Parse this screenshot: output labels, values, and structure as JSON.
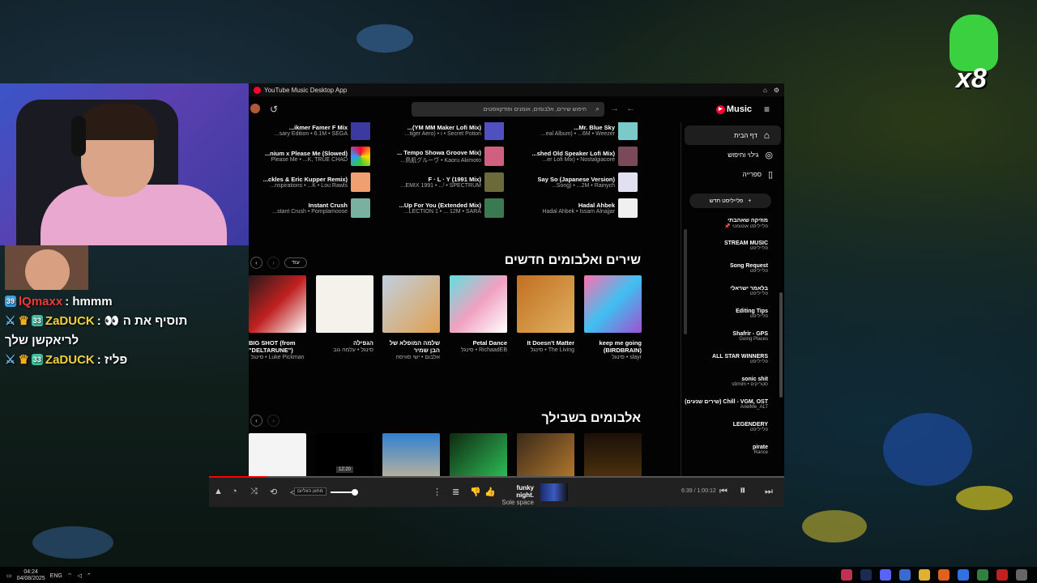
{
  "chat": {
    "lines": [
      {
        "name": "lQmaxx",
        "msg": ": hmmm"
      },
      {
        "name": "ZaDUCK",
        "msg": ": 👀 תוסיף את ה"
      },
      {
        "name": "",
        "msg": "לריאקשן שלך"
      },
      {
        "name": "ZaDUCK",
        "msg": ": פליז"
      }
    ],
    "badge_sub": "39",
    "badge_33": "33"
  },
  "overlay": {
    "counter": "x8"
  },
  "window": {
    "title": "YouTube Music Desktop App"
  },
  "topbar": {
    "search_placeholder": "חיפוש שירים, אלבומים, אומנים ופודקאסטים",
    "brand": "Music",
    "back": "←",
    "forward": "→"
  },
  "quick_picks": [
    [
      {
        "t1": "...ikmer Famer F Mix",
        "t2": "...sary Edition • 6.1M • SEGA",
        "c": "#3a3aa0"
      },
      {
        "t1": "...nium x Please Me (Slowed)",
        "t2": "Please Me • ...K, TRUE CHAD",
        "c": "#ffd020"
      },
      {
        "t1": "...ckles & Eric Kupper Remix)",
        "t2": "...nspirations • ...K • Lou Rawls",
        "c": "#f0a070"
      },
      {
        "t1": "Instant Crush",
        "t2": "...stant Crush • Pomplamoose",
        "c": "#7ab0a0"
      }
    ],
    [
      {
        "t1": "...(YM MM Maker Lofi Mix)",
        "t2": "...tiger Aero) • i • Secret Potion",
        "c": "#5050c0"
      },
      {
        "t1": "... Tempo Showa Groove Mix)",
        "t2": "...鳥肌グルーヴ • Kaoru Akimoto",
        "c": "#d06080"
      },
      {
        "t1": "F · L · Y (1991 Mix)",
        "t2": "...EMIX 1991 • ...ᴵ • SPECTRUM",
        "c": "#6a6a3a"
      },
      {
        "t1": "...Up For You (Extended Mix)",
        "t2": "...LECTION 1 • ... 12M • SARA",
        "c": "#3a7a50"
      }
    ],
    [
      {
        "t1": "...Mr. Blue Sky",
        "t2": "...eal Album) • ...6M • Weezer",
        "c": "#7acaca"
      },
      {
        "t1": "...shed Old Speaker Lofi Mix)",
        "t2": "...er Lofi Mix) • Nostalgiacore",
        "c": "#7a4a5a"
      },
      {
        "t1": "Say So (Japanese Version)",
        "t2": "...Song) • ...2M • Rainych",
        "c": "#e0e0f0"
      },
      {
        "t1": "Hadal Ahbek",
        "t2": "Hadal Ahbek • Issam Alnajjar",
        "c": "#f0f0f0"
      }
    ]
  ],
  "new_releases": {
    "title": "שירים ואלבומים חדשים",
    "more": "עוד",
    "cards": [
      {
        "title": "keep me going (BIRDBRAIN)",
        "sub": "סינגל • slayr",
        "c": "linear-gradient(135deg,#ff70b0,#40c0f0,#a050d0)"
      },
      {
        "title": "It Doesn't Matter",
        "sub": "סינגל • The Living",
        "c": "linear-gradient(135deg,#c07020,#e0b060)"
      },
      {
        "title": "Petal Dance",
        "sub": "סינגל • RichaadEB",
        "c": "linear-gradient(135deg,#60e0e0,#f0a0c0,#fff)"
      },
      {
        "title": "שלמה המופלא של הבן שמיר",
        "sub": "אלבום • ישי סוויסה",
        "c": "linear-gradient(135deg,#c0d0e0,#e0a050)"
      },
      {
        "title": "הגפילה",
        "sub": "סינגל • עלמה גוב",
        "c": "#f4f2ea"
      },
      {
        "title": "BIG SHOT (from \"DELTARUNE\")",
        "sub": "סינגל • Luke Pickman",
        "c": "linear-gradient(135deg,#2a1a1a,#c02020,#fff)"
      }
    ]
  },
  "albums_for_you": {
    "title": "אלבומים בשבילך",
    "cards": [
      {
        "c": "linear-gradient(180deg,#1a1008,#5a3a10)"
      },
      {
        "c": "linear-gradient(135deg,#3a2a1a,#c08030)"
      },
      {
        "c": "linear-gradient(135deg,#102a10,#30d060)"
      },
      {
        "c": "linear-gradient(180deg,#3080d0,#e0c090)"
      },
      {
        "c": "#000"
      },
      {
        "c": "#f4f4f4"
      }
    ]
  },
  "sidebar": {
    "nav": [
      {
        "label": "דף הבית",
        "icon": "home-icon",
        "glyph": "⌂"
      },
      {
        "label": "גילוי וחיפוש",
        "icon": "explore-icon",
        "glyph": "◎"
      },
      {
        "label": "ספרייה",
        "icon": "library-icon",
        "glyph": "▯"
      }
    ],
    "new_playlist": "פלייליסט חדש",
    "playlists": [
      {
        "n": "מוזיקה שאהבתי",
        "s": "📌 פלייליסט אוטומטי"
      },
      {
        "n": "STREAM MUSIC",
        "s": "פלייליסט"
      },
      {
        "n": "Song Request",
        "s": "פלייליסט"
      },
      {
        "n": "בלאמר ישראלי",
        "s": "פלייליסט"
      },
      {
        "n": "Editing Tips",
        "s": "פלייליסט"
      },
      {
        "n": "Shafrir - GPS",
        "s": "Going Places"
      },
      {
        "n": "ALL STAR WINNERS",
        "s": "פלייליסט"
      },
      {
        "n": "sonic shit",
        "s": "stirnim • סטריקים"
      },
      {
        "n": "(שירים שנעים) Chill - VGM, OST",
        "s": "ArielMe_ALT"
      },
      {
        "n": "LEGENDERY",
        "s": "פלייליסט"
      },
      {
        "n": "pirate",
        "s": "Rance"
      }
    ]
  },
  "player": {
    "title": "funky night.",
    "artist": "Sole space",
    "time": "6:39 / 1:00:12",
    "tooltip": "מחוון הווליום",
    "time_tip": "12:20",
    "progress": 0.1
  },
  "taskbar": {
    "time": "04:24",
    "date": "04/08/2025",
    "lang": "ENG"
  }
}
